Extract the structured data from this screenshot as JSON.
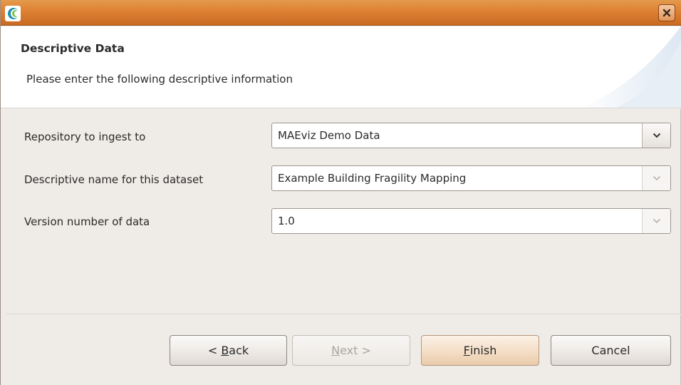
{
  "window": {
    "title": ""
  },
  "header": {
    "title": "Descriptive Data",
    "description": "Please enter the following descriptive information"
  },
  "form": {
    "fields": [
      {
        "label": "Repository to ingest to",
        "value": "MAEviz Demo Data",
        "enabled": true
      },
      {
        "label": "Descriptive name for this dataset",
        "value": "Example Building Fragility Mapping",
        "enabled": false
      },
      {
        "label": "Version number of data",
        "value": "1.0",
        "enabled": false
      }
    ]
  },
  "buttons": {
    "back": {
      "prefix": "< ",
      "mnemonic": "B",
      "rest": "ack"
    },
    "next": {
      "mnemonic": "N",
      "rest": "ext >"
    },
    "finish": {
      "mnemonic": "F",
      "rest": "inish"
    },
    "cancel": {
      "label": "Cancel"
    }
  },
  "colors": {
    "titlebar": "#e08436",
    "default_button": "#f3dcc3"
  },
  "icons": {
    "app": "crescent-logo-icon",
    "close": "close-icon",
    "dropdown": "chevron-down-icon"
  }
}
